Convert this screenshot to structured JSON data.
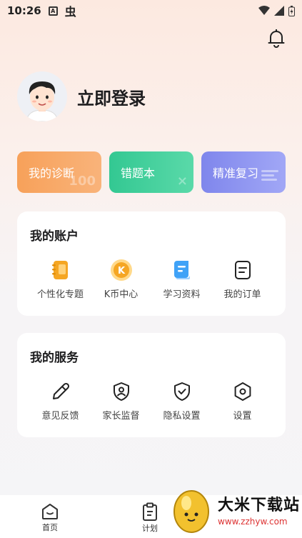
{
  "status_bar": {
    "time": "10:26"
  },
  "profile": {
    "login_label": "立即登录"
  },
  "quick_actions": [
    {
      "label": "我的诊断",
      "deco": "100"
    },
    {
      "label": "错题本",
      "deco": "×"
    },
    {
      "label": "精准复习",
      "deco": ""
    }
  ],
  "account": {
    "title": "我的账户",
    "items": [
      {
        "label": "个性化专题",
        "icon": "notebook-icon"
      },
      {
        "label": "K币中心",
        "icon": "k-coin-icon"
      },
      {
        "label": "学习资料",
        "icon": "document-icon"
      },
      {
        "label": "我的订单",
        "icon": "order-icon"
      }
    ]
  },
  "service": {
    "title": "我的服务",
    "items": [
      {
        "label": "意见反馈",
        "icon": "pencil-icon"
      },
      {
        "label": "家长监督",
        "icon": "parent-shield-icon"
      },
      {
        "label": "隐私设置",
        "icon": "privacy-shield-icon"
      },
      {
        "label": "设置",
        "icon": "settings-icon"
      }
    ]
  },
  "tabbar": {
    "home": "首页",
    "plan": "计划"
  },
  "watermark": {
    "title": "大米下载站",
    "url": "www.zzhyw.com"
  },
  "colors": {
    "orange": "#f7a15a",
    "green": "#33c892",
    "purple": "#7f86ec",
    "coin": "#f5a623"
  }
}
